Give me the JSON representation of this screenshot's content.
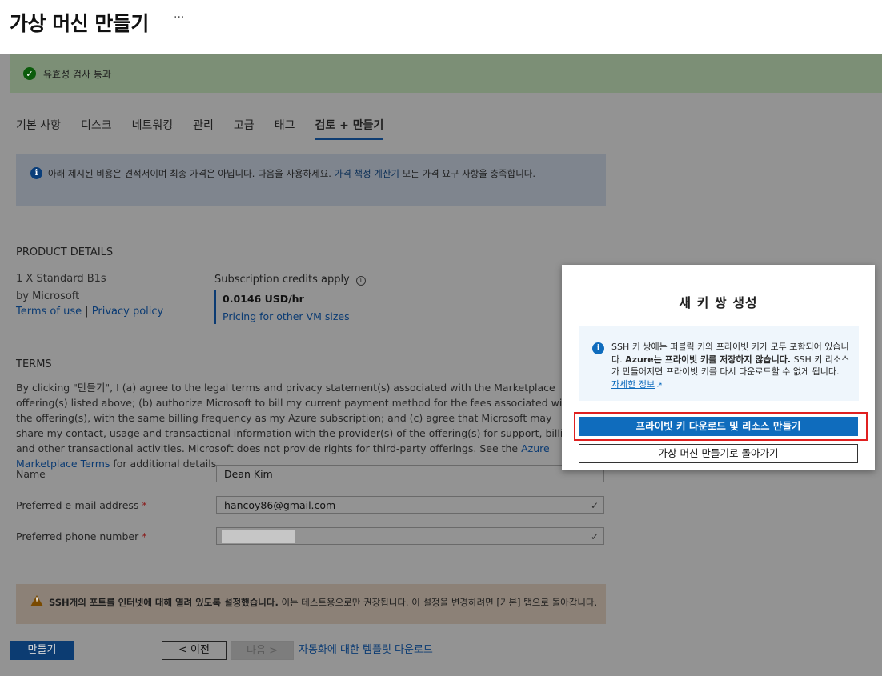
{
  "header": {
    "title": "가상 머신 만들기",
    "more": "···"
  },
  "validation": {
    "text": "유효성 검사 통과"
  },
  "tabs": [
    {
      "label": "기본 사항"
    },
    {
      "label": "디스크"
    },
    {
      "label": "네트워킹"
    },
    {
      "label": "관리"
    },
    {
      "label": "고급"
    },
    {
      "label": "태그"
    },
    {
      "label": "검토 + 만들기",
      "active": true
    }
  ],
  "info": {
    "text_before": "아래 제시된 비용은 견적서이며 최종 가격은 아닙니다. 다음을 사용하세요.",
    "link": "가격 책정 계산기",
    "text_after": "모든 가격 요구 사항을 충족합니다."
  },
  "product": {
    "title": "PRODUCT DETAILS",
    "name": "1 X Standard B1s",
    "by": "by Microsoft",
    "terms_link": "Terms of use",
    "separator": " | ",
    "privacy_link": "Privacy policy",
    "credits": "Subscription credits apply",
    "price": "0.0146 USD/hr",
    "pricing_link": "Pricing for other VM sizes"
  },
  "terms": {
    "title": "TERMS",
    "text": "By clicking \"만들기\", I (a) agree to the legal terms and privacy statement(s) associated with the Marketplace offering(s) listed above; (b) authorize Microsoft to bill my current payment method for the fees associated with the offering(s), with the same billing frequency as my Azure subscription; and (c) agree that Microsoft may share my contact, usage and transactional information with the provider(s) of the offering(s) for support, billing and other transactional activities. Microsoft does not provide rights for third-party offerings. See the",
    "link": "Azure Marketplace Terms",
    "text_end": "for additional details."
  },
  "form": {
    "name_label": "Name",
    "name_value": "Dean Kim",
    "email_label": "Preferred e-mail address",
    "email_value": "hancoy86@gmail.com",
    "phone_label": "Preferred phone number",
    "required": "*"
  },
  "warning": {
    "bold": "SSH개의 포트를 인터넷에 대해 열려 있도록 설정했습니다.",
    "text": "이는 테스트용으로만 권장됩니다. 이 설정을 변경하려면 [기본] 탭으로 돌아갑니다."
  },
  "footer": {
    "create": "만들기",
    "prev": "< 이전",
    "next": "다음 >",
    "template_link": "자동화에 대한 템플릿 다운로드"
  },
  "dialog": {
    "title": "새 키 쌍 생성",
    "info_1": "SSH 키 쌍에는 퍼블릭 키와 프라이빗 키가 모두 포함되어 있습니다.",
    "info_bold": "Azure는 프라이빗 키를 저장하지 않습니다.",
    "info_2": "SSH 키 리소스가 만들어지면 프라이빗 키를 다시 다운로드할 수 없게 됩니다.",
    "info_link": "자세한 정보",
    "download_button": "프라이빗 키 다운로드 및 리소스 만들기",
    "back_button": "가상 머신 만들기로 돌아가기"
  }
}
